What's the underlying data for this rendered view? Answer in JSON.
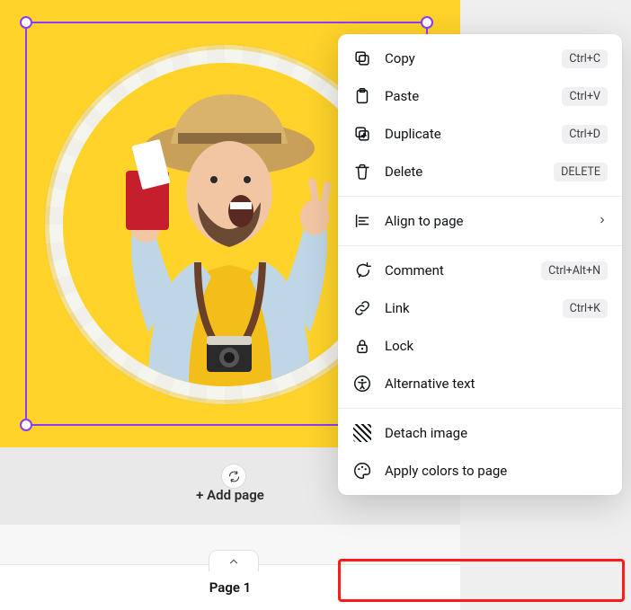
{
  "canvas": {
    "background_color": "#ffd32a",
    "selection_color": "#8b3dff"
  },
  "controls": {
    "add_page_label": "+ Add page",
    "page_label": "Page 1"
  },
  "context_menu": {
    "callout_item": "apply_colors",
    "items": {
      "copy": {
        "label": "Copy",
        "shortcut": "Ctrl+C"
      },
      "paste": {
        "label": "Paste",
        "shortcut": "Ctrl+V"
      },
      "duplicate": {
        "label": "Duplicate",
        "shortcut": "Ctrl+D"
      },
      "delete": {
        "label": "Delete",
        "shortcut": "DELETE"
      },
      "align": {
        "label": "Align to page"
      },
      "comment": {
        "label": "Comment",
        "shortcut": "Ctrl+Alt+N"
      },
      "link": {
        "label": "Link",
        "shortcut": "Ctrl+K"
      },
      "lock": {
        "label": "Lock"
      },
      "alt": {
        "label": "Alternative text"
      },
      "detach": {
        "label": "Detach image"
      },
      "apply_colors": {
        "label": "Apply colors to page"
      }
    }
  },
  "callout_color": "#ff1a1a"
}
